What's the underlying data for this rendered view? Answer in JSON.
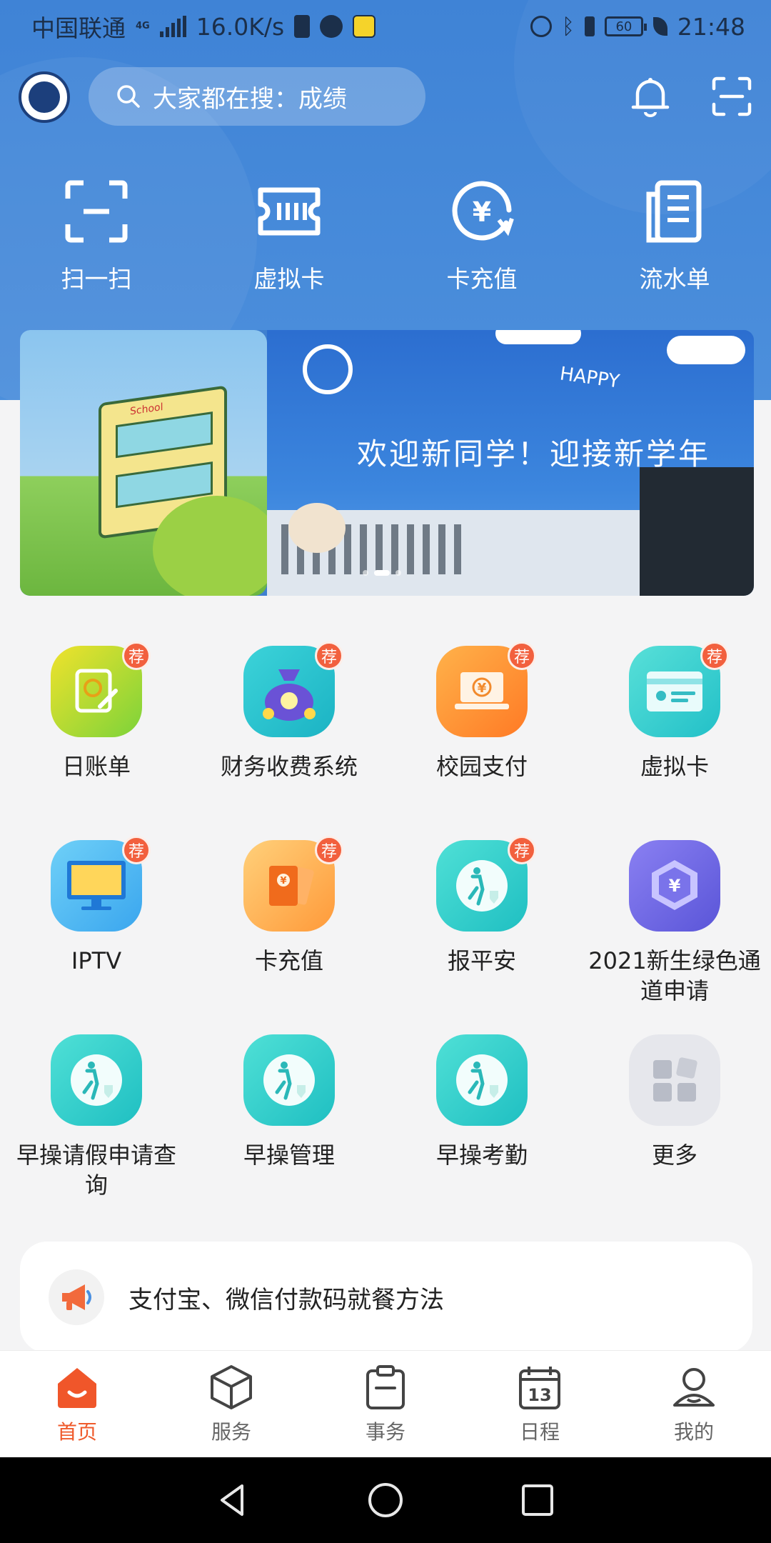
{
  "status_bar": {
    "carrier": "中国联通",
    "network": "4G",
    "speed": "16.0K/s",
    "battery": "60",
    "time": "21:48"
  },
  "header": {
    "search_placeholder": "大家都在搜：成绩"
  },
  "quick_actions": [
    {
      "label": "扫一扫",
      "icon": "scan-icon"
    },
    {
      "label": "虚拟卡",
      "icon": "virtual-card-icon"
    },
    {
      "label": "卡充值",
      "icon": "card-recharge-icon"
    },
    {
      "label": "流水单",
      "icon": "statement-icon"
    }
  ],
  "banner": {
    "headline": "欢迎新同学！迎接新学年",
    "tag": "HAPPY",
    "sign": "School"
  },
  "apps": [
    {
      "label": "日账单",
      "badge": "荐",
      "icon": "daily-bill-icon"
    },
    {
      "label": "财务收费系统",
      "badge": "荐",
      "icon": "finance-fee-icon"
    },
    {
      "label": "校园支付",
      "badge": "荐",
      "icon": "campus-pay-icon"
    },
    {
      "label": "虚拟卡",
      "badge": "荐",
      "icon": "virtual-card-icon"
    },
    {
      "label": "IPTV",
      "badge": "荐",
      "icon": "tv-icon"
    },
    {
      "label": "卡充值",
      "badge": "荐",
      "icon": "card-recharge-icon"
    },
    {
      "label": "报平安",
      "badge": "荐",
      "icon": "safety-report-icon"
    },
    {
      "label": "2021新生绿色通道申请",
      "badge": "",
      "icon": "green-channel-icon"
    },
    {
      "label": "早操请假申请查询",
      "badge": "",
      "icon": "exercise-leave-icon"
    },
    {
      "label": "早操管理",
      "badge": "",
      "icon": "exercise-manage-icon"
    },
    {
      "label": "早操考勤",
      "badge": "",
      "icon": "exercise-attendance-icon"
    },
    {
      "label": "更多",
      "badge": "",
      "icon": "more-icon"
    }
  ],
  "notice": {
    "text": "支付宝、微信付款码就餐方法"
  },
  "tabs": [
    {
      "label": "首页",
      "active": true
    },
    {
      "label": "服务",
      "active": false
    },
    {
      "label": "事务",
      "active": false
    },
    {
      "label": "日程",
      "active": false
    },
    {
      "label": "我的",
      "active": false
    }
  ],
  "colors": {
    "header_blue": "#3f83d6",
    "active_tab": "#ef5a2b",
    "badge": "#f2603e"
  }
}
